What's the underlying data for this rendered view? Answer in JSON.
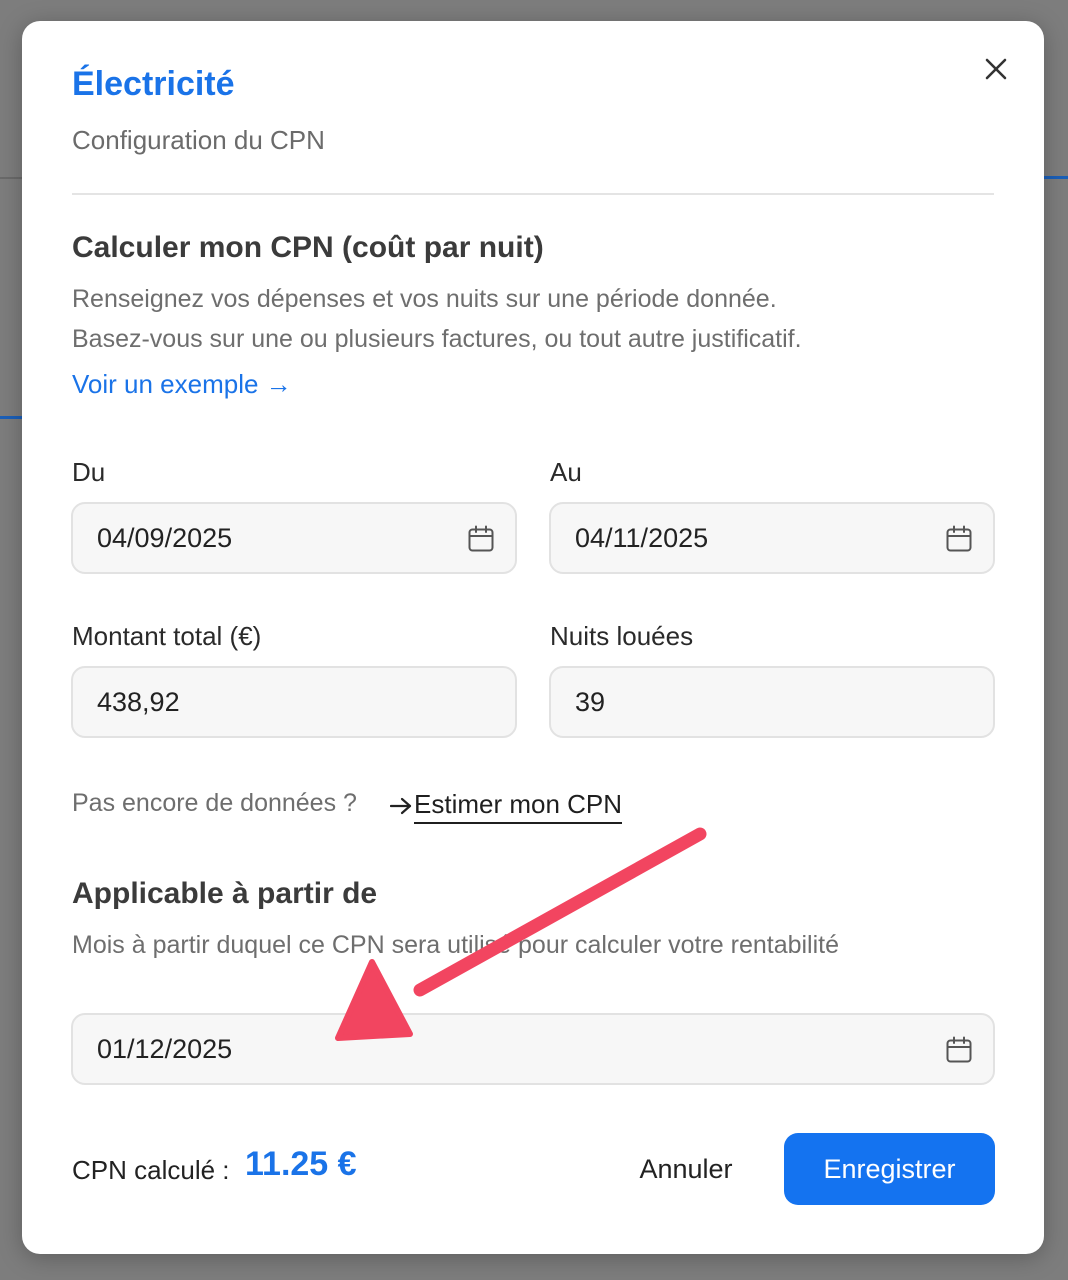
{
  "modal": {
    "title": "Électricité",
    "subtitle": "Configuration du CPN",
    "calc_section": {
      "title": "Calculer mon CPN (coût par nuit)",
      "desc_line1": "Renseignez vos dépenses et vos nuits sur une période donnée.",
      "desc_line2": "Basez-vous sur une ou plusieurs factures, ou tout autre justificatif.",
      "example_link": "Voir un exemple →"
    },
    "fields": {
      "from_label": "Du",
      "from_value": "04/09/2025",
      "to_label": "Au",
      "to_value": "04/11/2025",
      "amount_label": "Montant total (€)",
      "amount_value": "438,92",
      "nights_label": "Nuits louées",
      "nights_value": "39"
    },
    "no_data_hint": "Pas encore de données ?",
    "estimate_link": "Estimer mon CPN",
    "applicable": {
      "title": "Applicable à partir de",
      "desc": "Mois à partir duquel ce CPN sera utilisé pour calculer votre rentabilité",
      "date_value": "01/12/2025"
    },
    "footer": {
      "cpn_label": "CPN calculé :",
      "cpn_value": "11.25 €",
      "cancel_label": "Annuler",
      "save_label": "Enregistrer"
    }
  },
  "icons": {
    "close": "close-icon",
    "calendar": "calendar-icon",
    "arrow": "arrow-right-icon"
  },
  "colors": {
    "accent": "#1a73e8",
    "primary_button": "#1473f0",
    "annotation_arrow": "#f24560",
    "overlay": "#7d7d7d"
  }
}
